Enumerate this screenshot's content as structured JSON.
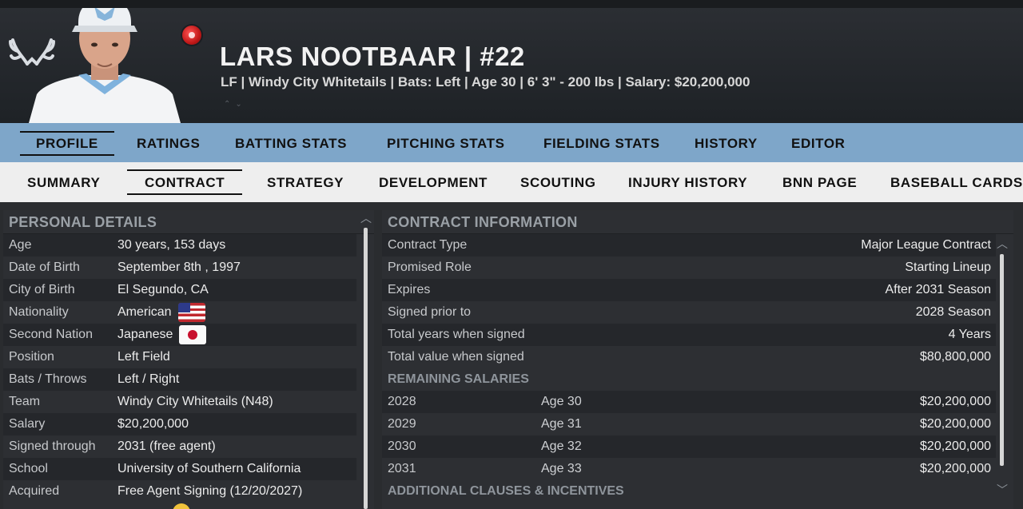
{
  "header": {
    "player_name": "LARS NOOTBAAR  |  #22",
    "player_meta": "LF | Windy City Whitetails  |  Bats: Left  |  Age 30  |  6' 3\"  - 200 lbs  |  Salary: $20,200,000",
    "logo_icon": "antlers-logo-icon",
    "badge_icon": "status-badge-icon",
    "colors": {
      "nav_primary": "#7ea6c9",
      "nav_secondary": "#eeeeee",
      "panel_bg": "#2d2f33"
    }
  },
  "nav_primary": {
    "tabs": [
      {
        "label": "PROFILE",
        "active": true
      },
      {
        "label": "RATINGS"
      },
      {
        "label": "BATTING STATS"
      },
      {
        "label": "PITCHING STATS"
      },
      {
        "label": "FIELDING STATS"
      },
      {
        "label": "HISTORY"
      },
      {
        "label": "EDITOR"
      }
    ]
  },
  "nav_secondary": {
    "tabs": [
      {
        "label": "SUMMARY"
      },
      {
        "label": "CONTRACT",
        "active": true
      },
      {
        "label": "STRATEGY"
      },
      {
        "label": "DEVELOPMENT"
      },
      {
        "label": "SCOUTING"
      },
      {
        "label": "INJURY HISTORY"
      },
      {
        "label": "BNN PAGE"
      },
      {
        "label": "BASEBALL CARDS"
      }
    ]
  },
  "personal": {
    "title": "PERSONAL DETAILS",
    "rows": [
      {
        "label": "Age",
        "value": "30 years, 153 days"
      },
      {
        "label": "Date of Birth",
        "value": "September 8th , 1997"
      },
      {
        "label": "City of Birth",
        "value": "El Segundo, CA"
      },
      {
        "label": "Nationality",
        "value": "American"
      },
      {
        "label": "Second Nation",
        "value": "Japanese"
      },
      {
        "label": "Position",
        "value": "Left Field"
      },
      {
        "label": "Bats / Throws",
        "value": "Left / Right"
      },
      {
        "label": "Team",
        "value": "Windy City Whitetails (N48)"
      },
      {
        "label": "Salary",
        "value": "$20,200,000"
      },
      {
        "label": "Signed through",
        "value": "2031 (free agent)"
      },
      {
        "label": "School",
        "value": "University of Southern California"
      },
      {
        "label": "Acquired",
        "value": "Free Agent Signing (12/20/2027)"
      }
    ]
  },
  "contract": {
    "title": "CONTRACT INFORMATION",
    "rows": [
      {
        "label": "Contract Type",
        "value": "Major League Contract"
      },
      {
        "label": "Promised Role",
        "value": "Starting Lineup"
      },
      {
        "label": "Expires",
        "value": "After 2031 Season"
      },
      {
        "label": "Signed prior to",
        "value": "2028 Season"
      },
      {
        "label": "Total years when signed",
        "value": "4 Years"
      },
      {
        "label": "Total value when signed",
        "value": "$80,800,000"
      }
    ],
    "remaining_title": "REMAINING SALARIES",
    "salaries": [
      {
        "year": "2028",
        "age": "Age 30",
        "amount": "$20,200,000"
      },
      {
        "year": "2029",
        "age": "Age 31",
        "amount": "$20,200,000"
      },
      {
        "year": "2030",
        "age": "Age 32",
        "amount": "$20,200,000"
      },
      {
        "year": "2031",
        "age": "Age 33",
        "amount": "$20,200,000"
      }
    ],
    "clauses_title": "ADDITIONAL CLAUSES & INCENTIVES"
  }
}
